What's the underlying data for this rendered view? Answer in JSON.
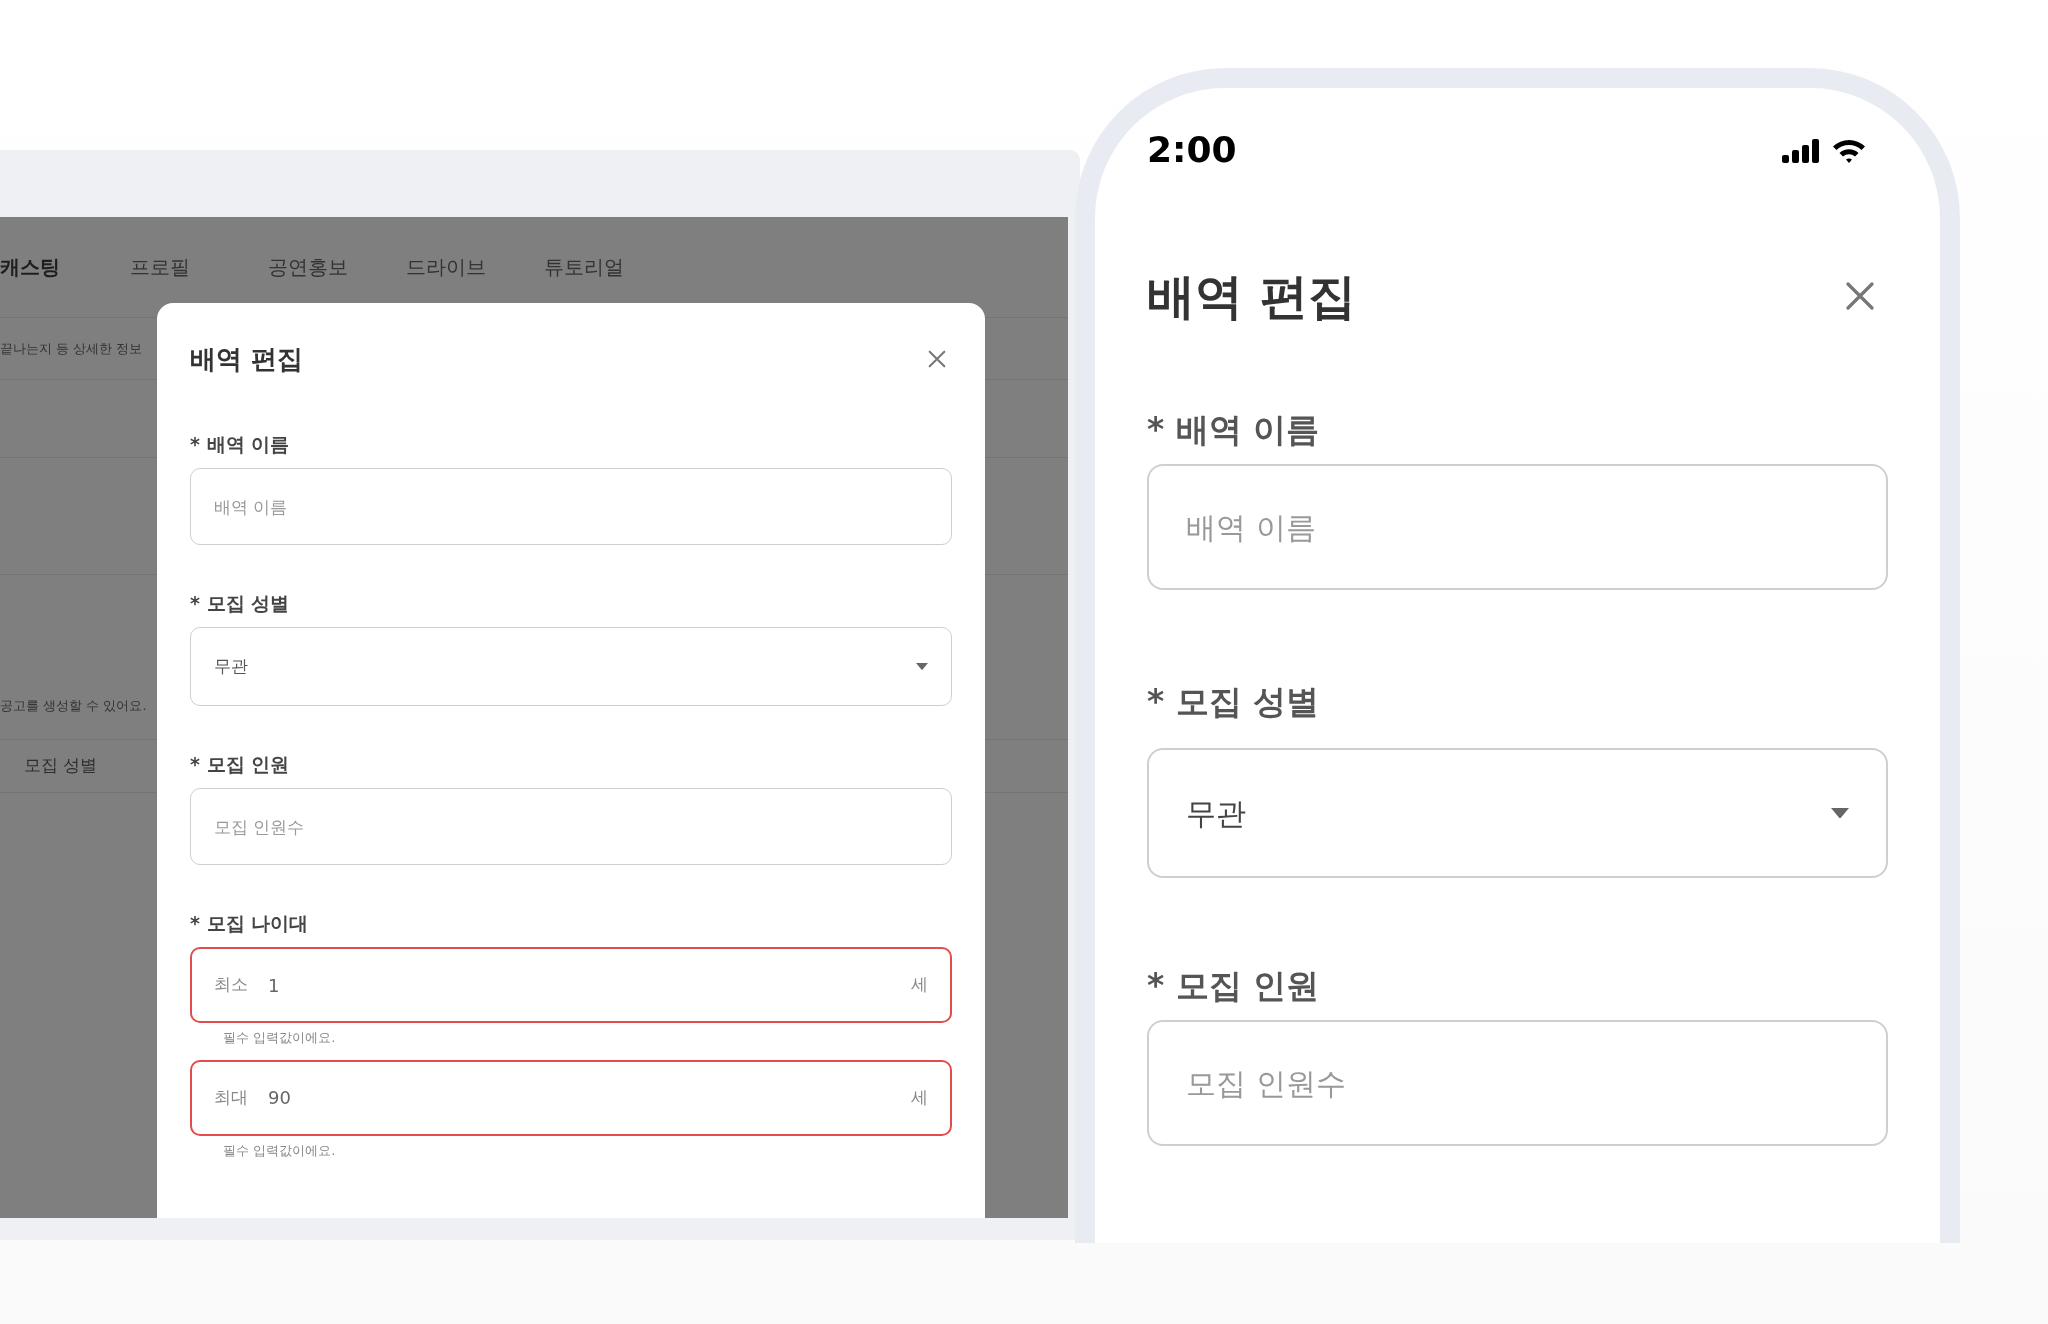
{
  "laptop": {
    "nav_tabs": [
      {
        "label": "캐스팅",
        "selected": true
      },
      {
        "label": "프로필",
        "selected": false
      },
      {
        "label": "공연홍보",
        "selected": false
      },
      {
        "label": "드라이브",
        "selected": false
      },
      {
        "label": "튜토리얼",
        "selected": false
      }
    ],
    "info_text": "끝나는지 등 상세한 정보",
    "notice_text": "공고를 생성할 수 있어요.",
    "column_header": "모집 성별"
  },
  "modal": {
    "title": "배역 편집",
    "fields": [
      {
        "kind": "text",
        "label": "* 배역 이름",
        "placeholder": "배역 이름"
      },
      {
        "kind": "select",
        "label": "* 모집 성별",
        "value": "무관"
      },
      {
        "kind": "text",
        "label": "* 모집 인원",
        "placeholder": "모집 인원수"
      },
      {
        "kind": "range",
        "label": "* 모집 나이대",
        "inputs": [
          {
            "prefix": "최소",
            "value": "1",
            "unit": "세",
            "error": true,
            "helper": "필수 입력값이에요."
          },
          {
            "prefix": "최대",
            "value": "90",
            "unit": "세",
            "error": true,
            "helper": "필수 입력값이에요."
          }
        ]
      }
    ]
  },
  "phone": {
    "time": "2:00",
    "title": "배역 편집",
    "fields": [
      {
        "kind": "text",
        "label": "* 배역 이름",
        "placeholder": "배역 이름"
      },
      {
        "kind": "select",
        "label": "* 모집 성별",
        "value": "무관"
      },
      {
        "kind": "text",
        "label": "* 모집 인원",
        "placeholder": "모집 인원수"
      }
    ]
  }
}
